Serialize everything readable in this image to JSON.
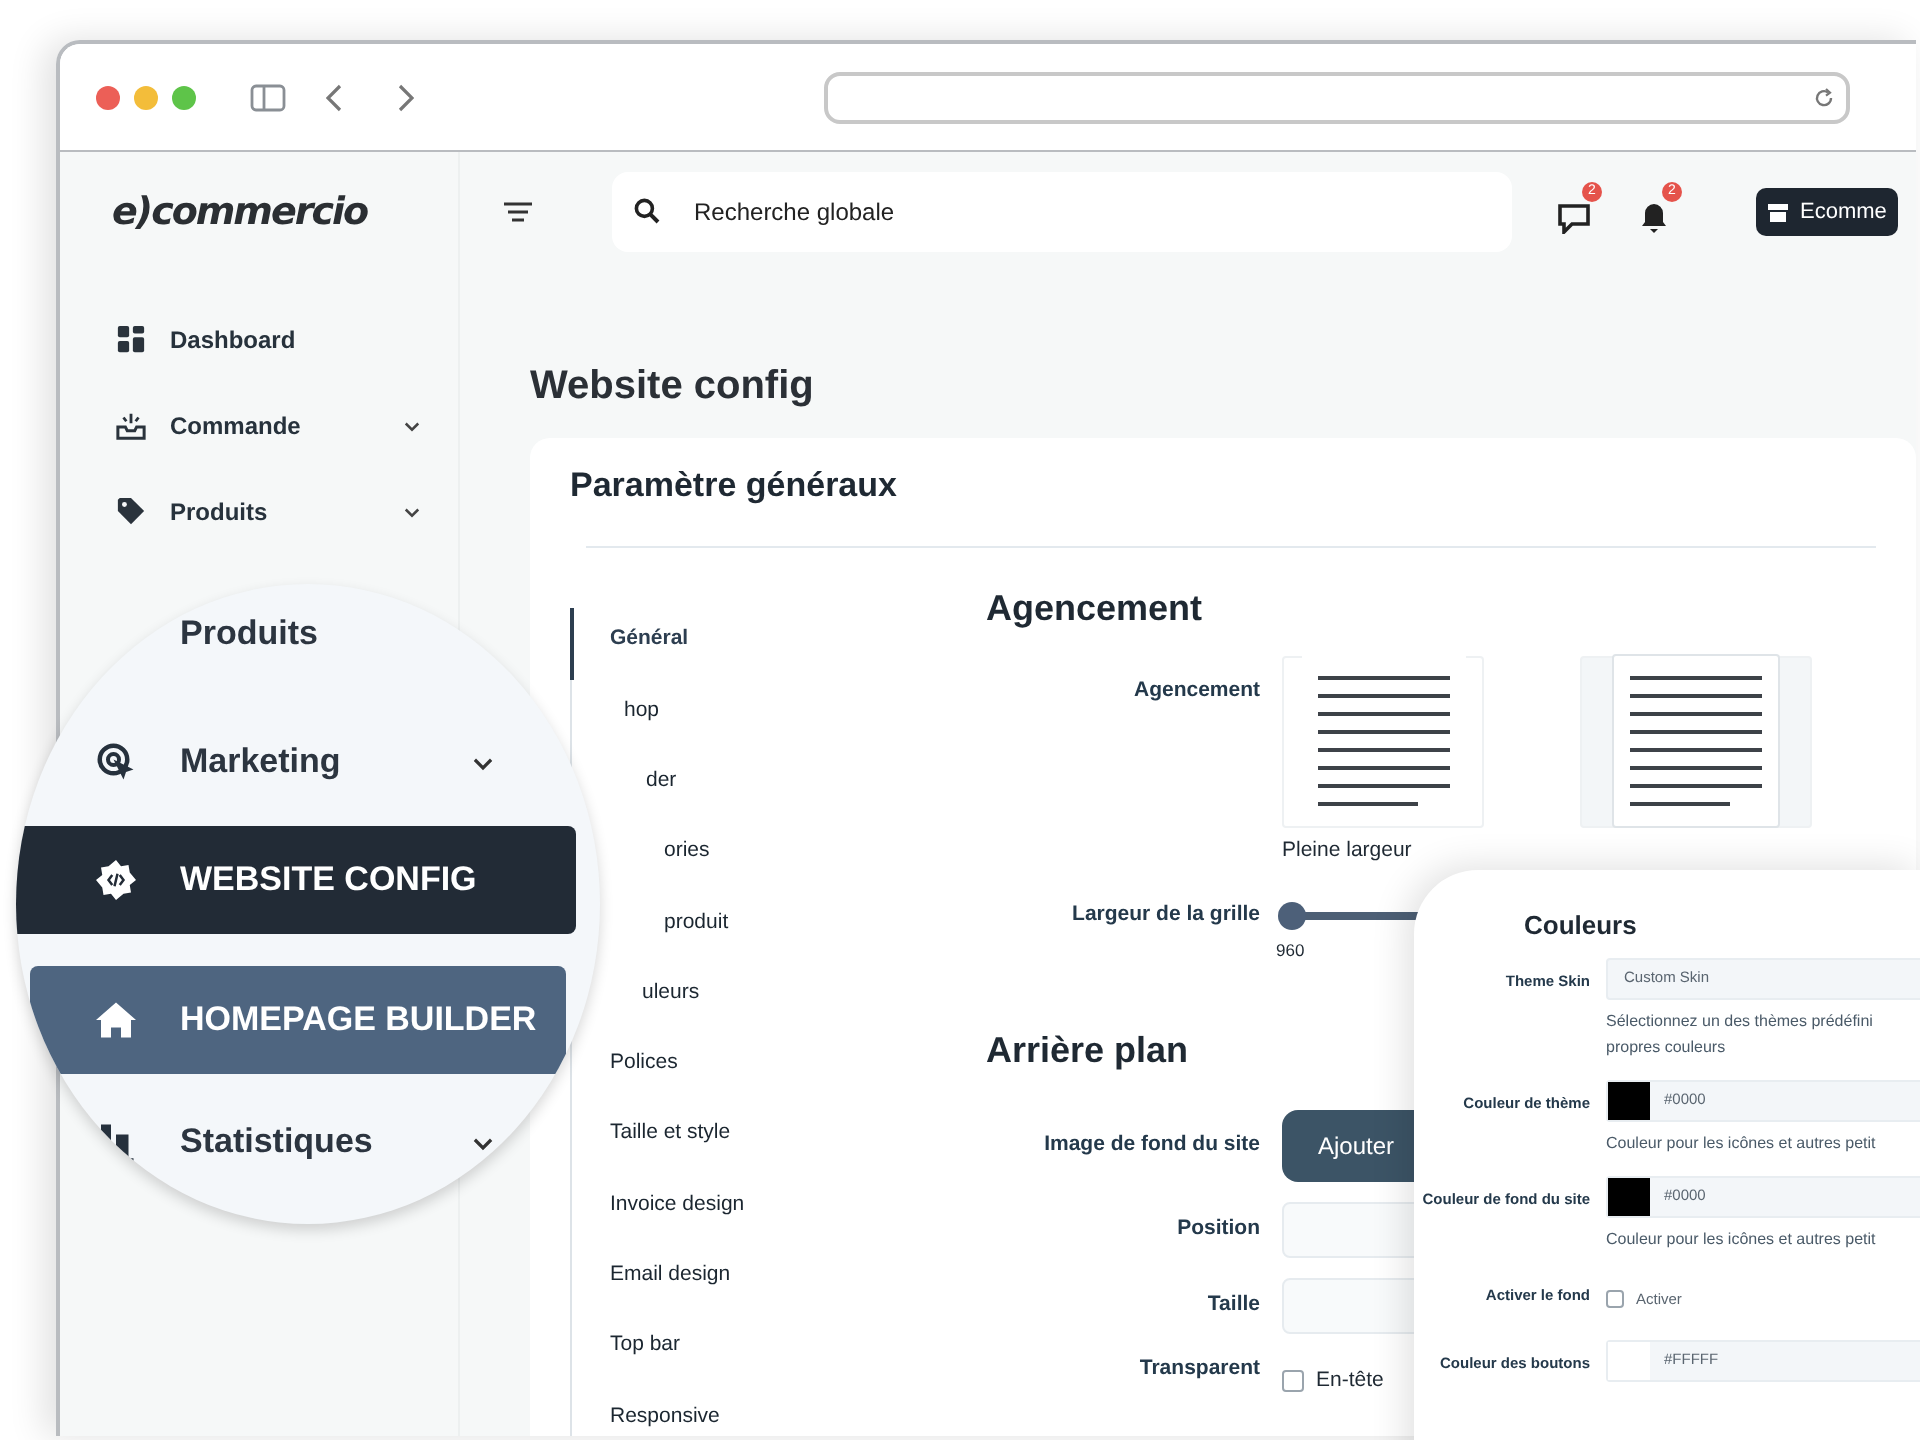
{
  "header": {
    "logo": "e)commercio",
    "search": {
      "placeholder": "Recherche globale"
    },
    "notifications": [
      {
        "kind": "messages",
        "count": "2"
      },
      {
        "kind": "alerts",
        "count": "2"
      }
    ],
    "store_button": "Ecomme"
  },
  "sidebar": {
    "items": [
      {
        "label": "Dashboard",
        "expandable": false
      },
      {
        "label": "Commande",
        "expandable": true
      },
      {
        "label": "Produits",
        "expandable": true
      }
    ]
  },
  "magnifier": {
    "items": [
      {
        "label": "Produits",
        "selected": false,
        "highlighted": false
      },
      {
        "label": "Marketing",
        "expandable": true,
        "selected": false,
        "highlighted": false
      },
      {
        "label": "WEBSITE CONFIG",
        "expandable": false,
        "selected": true,
        "highlighted": false
      },
      {
        "label": "HOMEPAGE BUILDER",
        "expandable": false,
        "selected": false,
        "highlighted": true
      },
      {
        "label": "Statistiques",
        "expandable": true,
        "selected": false,
        "highlighted": false
      }
    ]
  },
  "page": {
    "title": "Website config",
    "card_title": "Paramètre généraux",
    "tabs": [
      {
        "label": "Général",
        "selected": true
      },
      {
        "label": "hop",
        "selected": false
      },
      {
        "label": "der",
        "selected": false
      },
      {
        "label": "ories",
        "selected": false
      },
      {
        "label": "produit",
        "selected": false
      },
      {
        "label": "uleurs",
        "selected": false
      },
      {
        "label": "Polices",
        "selected": false
      },
      {
        "label": "Taille et style",
        "selected": false
      },
      {
        "label": "Invoice design",
        "selected": false
      },
      {
        "label": "Email design",
        "selected": false
      },
      {
        "label": "Top bar",
        "selected": false
      },
      {
        "label": "Responsive",
        "selected": false
      }
    ]
  },
  "layout": {
    "heading": "Agencement",
    "label": "Agencement",
    "options": [
      {
        "kind": "full",
        "label": "Pleine largeur"
      },
      {
        "kind": "boxed"
      }
    ],
    "grid": {
      "label": "Largeur de la grille",
      "level": 0,
      "reading": "960"
    }
  },
  "background": {
    "heading": "Arrière plan",
    "image": {
      "label": "Image de fond du site",
      "button": "Ajouter"
    },
    "fields": [
      {
        "label": "Position"
      },
      {
        "label": "Taille"
      }
    ],
    "transparent": {
      "label": "Transparent",
      "option": "En-tête",
      "checked": false
    }
  },
  "colors_panel": {
    "title": "Couleurs",
    "rows": [
      {
        "kind": "select",
        "label": "Theme Skin",
        "value": "Custom Skin",
        "help": [
          "Sélectionnez un des thèmes prédéfini",
          "propres couleurs"
        ]
      },
      {
        "kind": "color",
        "label": "Couleur de thème",
        "color": "#000000",
        "value": "#0000",
        "help": [
          "Couleur pour les icônes et autres petit"
        ]
      },
      {
        "kind": "color",
        "label": "Couleur de fond du site",
        "color": "#000000",
        "value": "#0000",
        "help": [
          "Couleur pour les icônes et autres petit"
        ]
      },
      {
        "kind": "checkbox",
        "label": "Activer le fond",
        "option": "Activer",
        "checked": false
      },
      {
        "kind": "color",
        "label": "Couleur des boutons",
        "color": "#ffffff",
        "value": "#FFFFF"
      }
    ]
  }
}
